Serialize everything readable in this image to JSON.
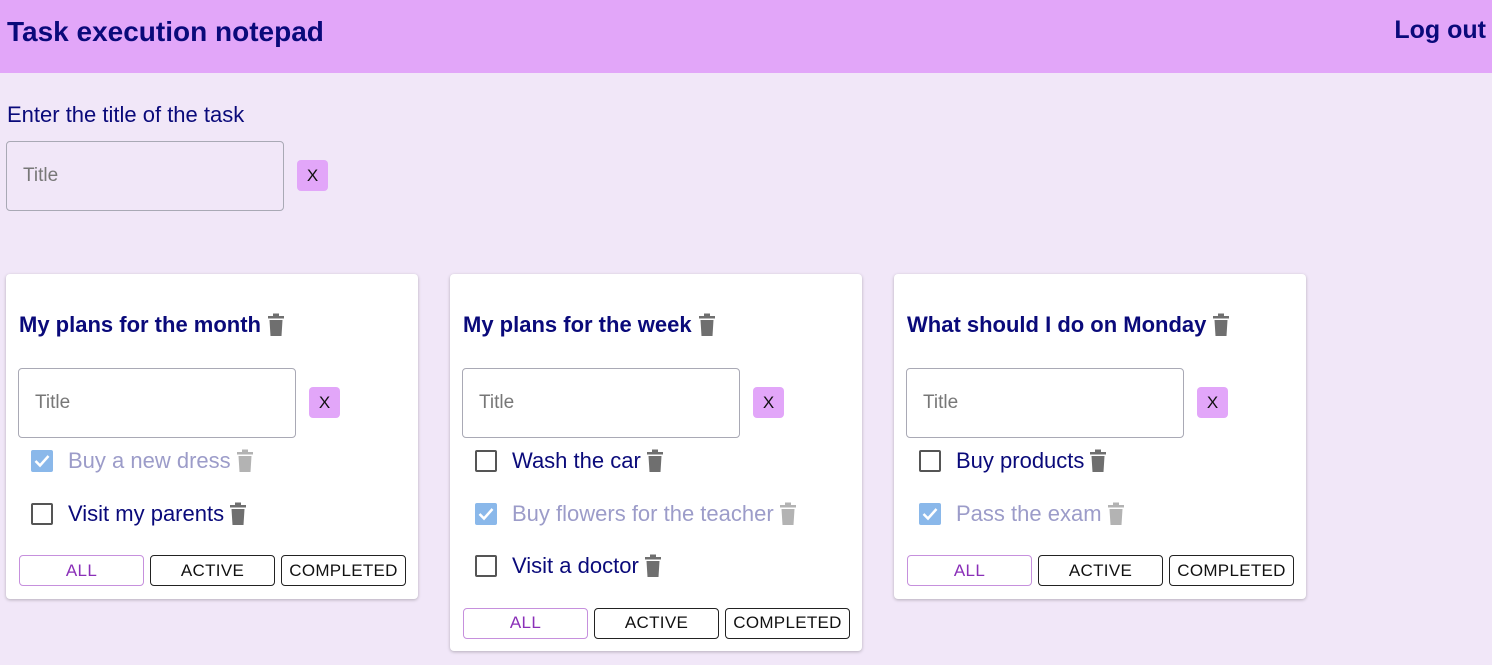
{
  "header": {
    "title": "Task execution notepad",
    "logout_label": "Log out"
  },
  "new_list": {
    "label": "Enter the title of the task",
    "placeholder": "Title",
    "add_label": "X"
  },
  "colors": {
    "header_bg": "#e2a6f9",
    "page_bg": "#f1e7f8",
    "text": "#0a0a7a",
    "checked": "#8ab8ea"
  },
  "lists": [
    {
      "title": "My plans for the month",
      "input_placeholder": "Title",
      "add_label": "X",
      "tasks": [
        {
          "label": "Buy a new dress",
          "done": true
        },
        {
          "label": "Visit my parents",
          "done": false
        }
      ],
      "filters": [
        "ALL",
        "ACTIVE",
        "COMPLETED"
      ],
      "active_filter": "ALL"
    },
    {
      "title": "My plans for the week",
      "input_placeholder": "Title",
      "add_label": "X",
      "tasks": [
        {
          "label": "Wash the car",
          "done": false
        },
        {
          "label": "Buy flowers for the teacher",
          "done": true
        },
        {
          "label": "Visit a doctor",
          "done": false
        }
      ],
      "filters": [
        "ALL",
        "ACTIVE",
        "COMPLETED"
      ],
      "active_filter": "ALL"
    },
    {
      "title": "What should I do on Monday",
      "input_placeholder": "Title",
      "add_label": "X",
      "tasks": [
        {
          "label": "Buy products",
          "done": false
        },
        {
          "label": "Pass the exam",
          "done": true
        }
      ],
      "filters": [
        "ALL",
        "ACTIVE",
        "COMPLETED"
      ],
      "active_filter": "ALL"
    }
  ]
}
